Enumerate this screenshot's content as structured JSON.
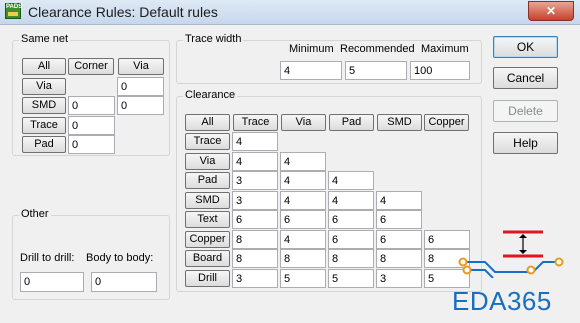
{
  "window": {
    "title": "Clearance Rules: Default rules",
    "app_icon_text": "PADS",
    "close_glyph": "✕"
  },
  "same_net": {
    "title": "Same net",
    "col_buttons": [
      "All",
      "Corner",
      "Via"
    ],
    "rows": [
      {
        "label": "Via",
        "values": [
          "",
          "0"
        ]
      },
      {
        "label": "SMD",
        "values": [
          "0",
          "0"
        ]
      },
      {
        "label": "Trace",
        "values": [
          "0"
        ]
      },
      {
        "label": "Pad",
        "values": [
          "0"
        ]
      }
    ]
  },
  "other": {
    "title": "Other",
    "drill_label": "Drill to drill:",
    "drill_value": "0",
    "body_label": "Body to body:",
    "body_value": "0"
  },
  "trace_width": {
    "title": "Trace width",
    "minimum_label": "Minimum",
    "recommended_label": "Recommended",
    "maximum_label": "Maximum",
    "minimum": "4",
    "recommended": "5",
    "maximum": "100"
  },
  "clearance": {
    "title": "Clearance",
    "col_buttons": [
      "All",
      "Trace",
      "Via",
      "Pad",
      "SMD",
      "Copper"
    ],
    "rows": [
      {
        "label": "Trace",
        "values": [
          "4"
        ]
      },
      {
        "label": "Via",
        "values": [
          "4",
          "4"
        ]
      },
      {
        "label": "Pad",
        "values": [
          "3",
          "4",
          "4"
        ]
      },
      {
        "label": "SMD",
        "values": [
          "3",
          "4",
          "4",
          "4"
        ]
      },
      {
        "label": "Text",
        "values": [
          "6",
          "6",
          "6",
          "6"
        ]
      },
      {
        "label": "Copper",
        "values": [
          "8",
          "4",
          "6",
          "6",
          "6"
        ]
      },
      {
        "label": "Board",
        "values": [
          "8",
          "8",
          "8",
          "8",
          "8"
        ]
      },
      {
        "label": "Drill",
        "values": [
          "3",
          "5",
          "5",
          "3",
          "5"
        ]
      }
    ]
  },
  "actions": {
    "ok": "OK",
    "cancel": "Cancel",
    "delete": "Delete",
    "help": "Help"
  },
  "watermark": {
    "text": "EDA365",
    "color": "#1a6ec0",
    "accent": "#e0141e"
  }
}
